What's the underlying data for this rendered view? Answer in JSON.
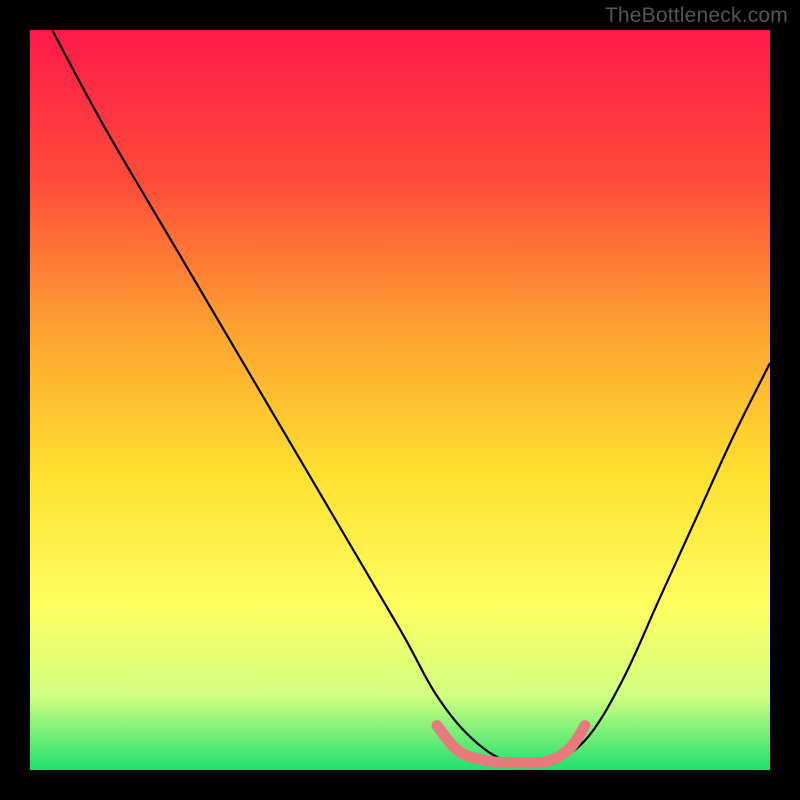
{
  "watermark": "TheBottleneck.com",
  "chart_data": {
    "type": "line",
    "title": "",
    "xlabel": "",
    "ylabel": "",
    "xlim": [
      0,
      100
    ],
    "ylim": [
      0,
      100
    ],
    "background_gradient": {
      "stops": [
        {
          "offset": 0,
          "color": "#ff1a4a"
        },
        {
          "offset": 20,
          "color": "#ff4a3a"
        },
        {
          "offset": 40,
          "color": "#ffa030"
        },
        {
          "offset": 60,
          "color": "#ffe030"
        },
        {
          "offset": 78,
          "color": "#ffff60"
        },
        {
          "offset": 90,
          "color": "#d0ff80"
        },
        {
          "offset": 100,
          "color": "#20e070"
        }
      ]
    },
    "series": [
      {
        "name": "bottleneck-curve",
        "x": [
          3,
          10,
          20,
          30,
          40,
          50,
          55,
          60,
          65,
          70,
          75,
          80,
          85,
          90,
          95,
          100
        ],
        "y": [
          100,
          87,
          70,
          53,
          36,
          19,
          10,
          4,
          1,
          1,
          4,
          12,
          23,
          34,
          45,
          55
        ]
      }
    ],
    "highlight_segment": {
      "name": "optimal-range",
      "color": "#e77a7a",
      "x": [
        55,
        58,
        62,
        66,
        70,
        73,
        75
      ],
      "y": [
        6,
        2.5,
        1.2,
        1,
        1.2,
        3,
        6
      ]
    }
  }
}
